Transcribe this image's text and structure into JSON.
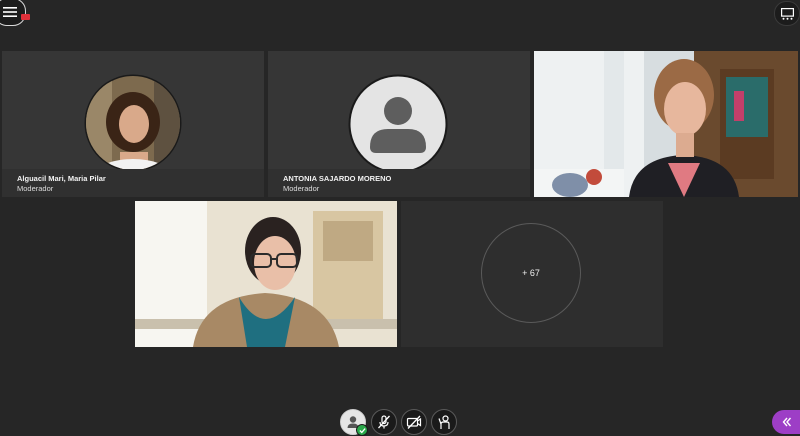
{
  "participants": [
    {
      "name": "Alguacil Mari, Maria Pilar",
      "role": "Moderador",
      "icon": "user-photo"
    },
    {
      "name": "ANTONIA SAJARDO MORENO",
      "role": "Moderador",
      "icon": "user-silhouette-icon"
    }
  ],
  "overflow": {
    "label": "+ 67"
  },
  "toolbar": {
    "icons": [
      "menu-icon",
      "recording-icon",
      "layout-icon",
      "user-status-icon",
      "mic-off-icon",
      "camera-off-icon",
      "raise-hand-icon",
      "collapse-chevron-icon"
    ]
  },
  "colors": {
    "background": "#262626",
    "tile": "#363636",
    "accent": "#9d3ec6",
    "status_ok": "#2aa84a",
    "recording": "#e0303a"
  }
}
